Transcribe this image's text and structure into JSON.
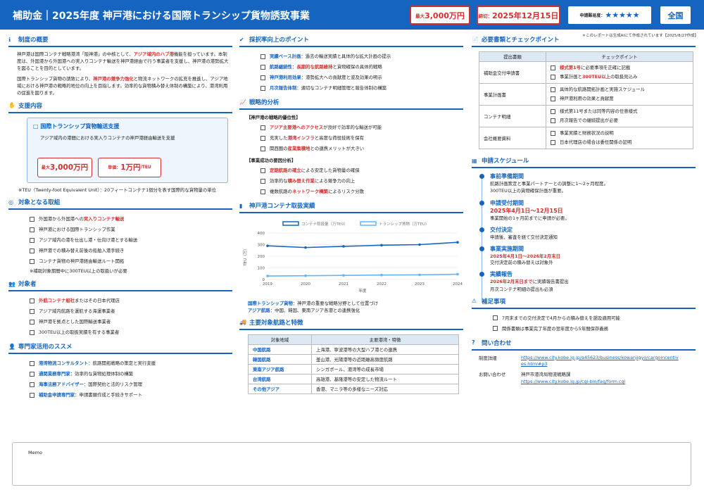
{
  "header": {
    "title": "補助金｜2025年度 神戸港における国際トランシップ貨物誘致事業",
    "max_label": "最大",
    "max_value": "3,000万円",
    "deadline_label": "締切：",
    "deadline_value": "2025年12月15日",
    "difficulty_label": "申請難易度：",
    "difficulty_stars": "★★★★★",
    "region_btn": "全国"
  },
  "note_top": "＊このレポートは生成AIにて作成されています【2025/8/27作成】",
  "overview": {
    "title": "制度の概要",
    "p1": [
      "神戸港は国際コンテナ戦略港湾「阪神港」の中核として、",
      "アジア域内のハブ港",
      "機能を担っています。本制度は、外国港から外国港への実入りコンテナ輸送を神戸港経由で行う事業者を支援し、神戸港の港勢拡大を図ることを目的としています。"
    ],
    "p2": [
      "国際トランシップ貨物の誘致により、",
      "神戸港の競争力強化",
      "と物流ネットワークの拡充を推進し、アジア地域における神戸港の戦略的地位の向上を目指します。効率的な貨物積み替え体制の構築により、港湾利用の促進を図ります。"
    ]
  },
  "support": {
    "title": "支援内容",
    "box_title": "□ 国際トランシップ貨物輸送支援",
    "box_desc": "アジア域内の港間における実入りコンテナの神戸港経由輸送を支援",
    "max_small": "最大",
    "max_big": "3,000万円",
    "unit_small": "単価：",
    "unit_big": "1万円",
    "unit_suffix": "/TEU",
    "note": "※TEU（Twenty-foot Equivalent Unit）：20フィートコンテナ1個分を表す国際的な貨物量の単位"
  },
  "targets": {
    "title": "対象となる取組",
    "items": [
      [
        "外国港から外国港への",
        "実入りコンテナ輸送",
        ""
      ],
      [
        "神戸港における国際トランシップ作業",
        "",
        ""
      ],
      [
        "アジア域内の港を仕出し港・仕向け港とする輸送",
        "",
        ""
      ],
      [
        "神戸港での積み替え前後の船舶入港手続き",
        "",
        ""
      ],
      [
        "コンテナ貨物の神戸港経由輸送ルート開拓",
        "",
        ""
      ]
    ],
    "note": "※補助対象期間中に300TEU以上の取扱いが必要"
  },
  "eligible": {
    "title": "対象者",
    "items": [
      [
        "",
        "外航コンテナ船社",
        "またはその日本代理店"
      ],
      [
        "アジア域内航路を運航する海運事業者",
        "",
        ""
      ],
      [
        "神戸港を拠点とした国際輸送事業者",
        "",
        ""
      ],
      [
        "300TEU以上の取扱実績を有する事業者",
        "",
        ""
      ]
    ]
  },
  "experts": {
    "title": "専門家活用のススメ",
    "items": [
      [
        "港湾物流コンサルタント",
        "：航路開拓戦略の策定と実行支援"
      ],
      [
        "通関業務専門家",
        "：効率的な貨物処理体制の構築"
      ],
      [
        "海事法務アドバイザー",
        "：国際契約と法的リスク管理"
      ],
      [
        "補助金申請専門家",
        "：申請書類作成と手続きサポート"
      ]
    ]
  },
  "points": {
    "title": "採択率向上のポイント",
    "items": [
      [
        "実績ベース計画",
        "：過去の輸送実績と具体的な拡大計画の提示"
      ],
      [
        "航路継続性",
        "：",
        "長期的な航路維持",
        "と貨物確保の具体的戦略"
      ],
      [
        "神戸港利用効果",
        "：港勢拡大への貢献度と波及効果の明示"
      ],
      [
        "月次報告体制",
        "：適切なコンテナ明細管理と報告体制の構築"
      ]
    ]
  },
  "strategy": {
    "title": "戦略的分析",
    "sub1": "【神戸港の戦略的優位性】",
    "items1": [
      [
        "",
        "アジア主要港へのアクセス",
        "が良好で効率的な輸送が可能"
      ],
      [
        "充実した",
        "港湾インフラ",
        "と高度な荷役技術を保有"
      ],
      [
        "関西圏の",
        "産業集積地",
        "との連携メリットが大きい"
      ]
    ],
    "sub2": "【事業成功の要因分析】",
    "items2": [
      [
        "",
        "定期航路の確立",
        "による安定した貨物量の確保"
      ],
      [
        "効率的な",
        "積み替え作業",
        "による競争力の向上"
      ],
      [
        "複数航路の",
        "ネットワーク構築",
        "によるリスク分散"
      ]
    ]
  },
  "chart": {
    "title": "神戸港コンテナ取扱実績",
    "note1_b": "国際トランシップ貨物",
    "note1": "：神戸港の重要な戦略分野として位置づけ",
    "note2_b": "アジア航路",
    "note2": "：中国、韓国、東南アジア各港との連携強化"
  },
  "chart_data": {
    "type": "line",
    "x": [
      "2019",
      "2020",
      "2021",
      "2022",
      "2023",
      "2024"
    ],
    "xlabel": "年度",
    "ylabel": "TEU（万）",
    "ylim": [
      0,
      400
    ],
    "yticks": [
      "0",
      "100",
      "200",
      "300",
      "400"
    ],
    "series": [
      {
        "name": "コンテナ取扱量（万TEU）",
        "values": [
          290,
          275,
          285,
          295,
          300,
          320
        ],
        "color": "#1565c0"
      },
      {
        "name": "トランシップ貨物（万TEU）",
        "values": [
          30,
          32,
          35,
          38,
          40,
          45
        ],
        "color": "#64b5f6"
      }
    ]
  },
  "routes": {
    "title": "主要対象航路と特徴",
    "h1": "対象地域",
    "h2": "主要港湾・特徴",
    "rows": [
      [
        "中国航路",
        "上海港、寧波港等の大型ハブ港との連携"
      ],
      [
        "韓国航路",
        "釜山港、光陽港等の近距離高頻度航路"
      ],
      [
        "東南アジア航路",
        "シンガポール、港湾等の成長市場"
      ],
      [
        "台湾航路",
        "高雄港、基隆港等の安定した物流ルート"
      ],
      [
        "その他アジア",
        "香港、マニラ等の多様なニーズ対応"
      ]
    ]
  },
  "docs": {
    "title": "必要書類とチェックポイント",
    "h1": "提出書類",
    "h2": "チェックポイント",
    "rows": [
      {
        "doc": "補助金交付申請書",
        "checks": [
          [
            "",
            "様式第1号",
            "に必要事項を正確に記載"
          ],
          [
            "事業計画と",
            "300TEU以上",
            "の取扱見込み"
          ]
        ]
      },
      {
        "doc": "事業計画書",
        "checks": [
          [
            "具体的な航路開拓計画と実施スケジュール",
            "",
            ""
          ],
          [
            "神戸港利用の効果と貢献度",
            "",
            ""
          ]
        ]
      },
      {
        "doc": "コンテナ明細",
        "checks": [
          [
            "様式第11号または同等内容の任意様式",
            "",
            ""
          ],
          [
            "月次報告での継続提出が必要",
            "",
            ""
          ]
        ]
      },
      {
        "doc": "会社概要資料",
        "checks": [
          [
            "事業実績と財務状況の説明",
            "",
            ""
          ],
          [
            "日本代理店の場合は委任関係の証明",
            "",
            ""
          ]
        ]
      }
    ]
  },
  "schedule": {
    "title": "申請スケジュール",
    "items": [
      {
        "title": "事前準備期間",
        "lines": [
          [
            "航路計画策定と事業パートナーとの調整に1〜2ヶ月程度。",
            ""
          ],
          [
            "300TEU以上の貨物確保計画が重要。",
            ""
          ]
        ]
      },
      {
        "title": "申請受付期間",
        "big": "2025年4月1日〜12月15日",
        "lines": [
          [
            "事業開始の1ヶ月前までに申請が必要。",
            ""
          ]
        ]
      },
      {
        "title": "交付決定",
        "lines": [
          [
            "申請後、審査を経て交付決定通知",
            ""
          ]
        ]
      },
      {
        "title": "事業実施期間",
        "red": "2025年4月1日〜2026年2月末日",
        "lines": [
          [
            "交付決定前の積み替えは対象外",
            ""
          ]
        ]
      },
      {
        "title": "実績報告",
        "red2": "2026年2月末日まで",
        "lines": [
          [
            "に実績報告書提出",
            ""
          ],
          [
            "月次コンテナ明細の提出も必須",
            ""
          ]
        ]
      }
    ]
  },
  "supp": {
    "title": "補足事項",
    "items": [
      "7月末までの交付決定で4月からの積み替えを遡及適用可能",
      "関係書類は事業完了年度の翌年度から5年間保存義務"
    ]
  },
  "contact": {
    "title": "問い合わせ",
    "l1": "制度詳細",
    "u1": "https://www.city.kobe.lg.jp/a45623/business/kowanjigyo/cargoincentives.html#p3",
    "l2": "お問い合わせ",
    "org": "神戸市港湾局物流戦略課",
    "u2": "https://www.city.kobe.lg.jp/cgi-bin/faq/form.cgi"
  },
  "memo": "Memo"
}
